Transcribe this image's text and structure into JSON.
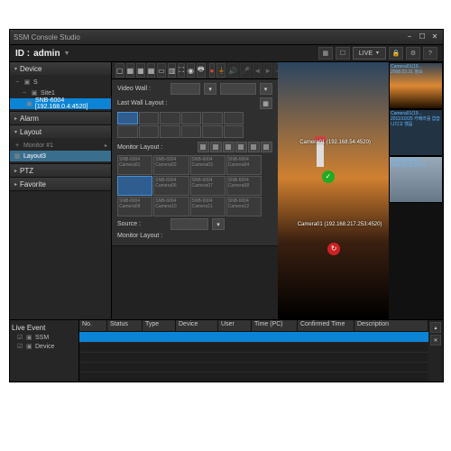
{
  "app": {
    "title": "SSM Console Studio"
  },
  "id": {
    "label": "ID :",
    "value": "admin"
  },
  "topbar": {
    "live": "LIVE"
  },
  "panels": {
    "device": "Device",
    "alarm": "Alarm",
    "layout": "Layout",
    "ptz": "PTZ",
    "favorite": "Favorite"
  },
  "deviceTree": {
    "root": "S",
    "site": "Site1",
    "cam": "SNB-6004 [192.168.0.4:4520]"
  },
  "layoutTree": {
    "monitor": "Monitor #1",
    "layout": "Layout3"
  },
  "config": {
    "videoWall": "Video Wall :",
    "lastWall": "Last Wall Layout :",
    "monitorLayout": "Monitor Layout :",
    "source": "Source :",
    "monitorLayout2": "Monitor Layout :"
  },
  "moncells": [
    {
      "line1": "SNB-6004",
      "line2": "Camera01"
    },
    {
      "line1": "SNB-6004",
      "line2": "Camera02"
    },
    {
      "line1": "SNB-6004",
      "line2": "Camera03"
    },
    {
      "line1": "SNB-6004",
      "line2": "Camera04"
    },
    {
      "line1": "",
      "line2": ""
    },
    {
      "line1": "SNB-6004",
      "line2": "Camera06"
    },
    {
      "line1": "SNB-6004",
      "line2": "Camera07"
    },
    {
      "line1": "SNB-6004",
      "line2": "Camera08"
    },
    {
      "line1": "SNB-6004",
      "line2": "Camera09"
    },
    {
      "line1": "SNB-6004",
      "line2": "Camera10"
    },
    {
      "line1": "SNB-6004",
      "line2": "Camera11"
    },
    {
      "line1": "SNB-6004",
      "line2": "Camera12"
    }
  ],
  "viewer": {
    "label1": "Camera01 (192.168.54:4520)",
    "label2": "Camera01 (192.168.217.253:4520)"
  },
  "thumbs": [
    {
      "title": "Camera01(19...",
      "date": "2008.03.31 월요"
    },
    {
      "title": "Camera01(19...",
      "date": "2011/10/25 카메라를 없습니다고 했읍"
    },
    {
      "title": "Camera01(19...",
      "date": "2013.10.22 17:31"
    }
  ],
  "event": {
    "title": "Live Event",
    "tree": {
      "ssm": "SSM",
      "device": "Device"
    },
    "cols": [
      "No.",
      "Status",
      "Type",
      "Device",
      "User",
      "Time (PC)",
      "Confirmed Time",
      "Description"
    ]
  }
}
